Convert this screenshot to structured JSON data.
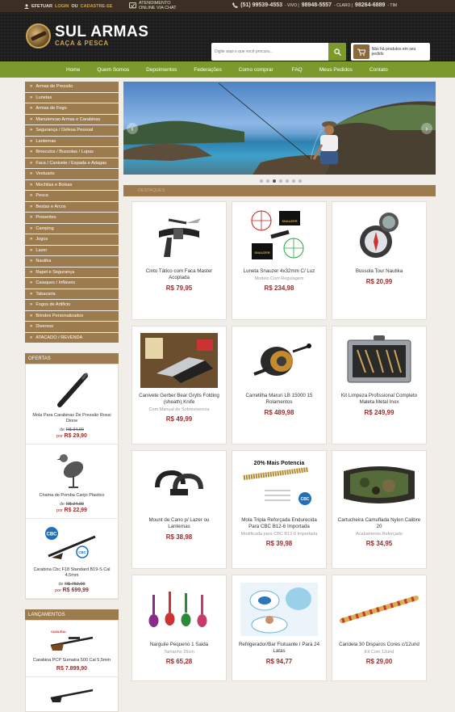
{
  "topbar": {
    "login_pre": "EFETUAR",
    "login_link": "LOGIN",
    "login_or": "OU",
    "register": "CADASTRE-SE",
    "atend_1": "ATENDIMENTO",
    "atend_2": "ONLINE VIA CHAT",
    "phone1": "(51) 99539-4553",
    "phone1_op": "- VIVO |",
    "phone2": "98948-5557",
    "phone2_op": "- CLARO |",
    "phone3": "98264-6889",
    "phone3_op": "- TIM"
  },
  "header": {
    "logo_title": "SUL ARMAS",
    "logo_sub": "CAÇA & PESCA",
    "search_placeholder": "Digite aqui o que você procura...",
    "cart_text": "Não há produtos em seu pedido"
  },
  "nav": [
    "Home",
    "Quem Somos",
    "Depoimentos",
    "Federações",
    "Como comprar",
    "FAQ",
    "Meus Pedidos",
    "Contato"
  ],
  "categories": [
    "Armas de Pressão",
    "Lunetas",
    "Armas de Fogo",
    "Manutencao Armas e Carabinas",
    "Segurança / Defesa Pessoal",
    "Lanternas",
    "Binoculos / Bussolas / Lupas",
    "Faca / Canivete / Espada e Adagas",
    "Vestuario",
    "Mochilas e Bolsas",
    "Pesca",
    "Bestas e Arcos",
    "Presentes",
    "Camping",
    "Jogos",
    "Lazer",
    "Nautika",
    "Rapel e Segurança",
    "Caiaques / Infláveis",
    "Tabacaria",
    "Fogos de Artificio",
    "Brindes Personalizados",
    "Diversos",
    "ATACADO / REVENDA"
  ],
  "offers": {
    "title": "OFERTAS",
    "de_label": "de",
    "por_label": "por",
    "items": [
      {
        "name": "Mola Para Carabinas De Pressão Rossi Dione",
        "old": "R$ 34,90",
        "new": "R$ 29,90"
      },
      {
        "name": "Chama de Pomba Carijo Plastico",
        "old": "R$ 24,90",
        "new": "R$ 22,99"
      },
      {
        "name": "Carabina Cbc F18 Standard B19-S Cal 4,5mm",
        "old": "R$ 759,99",
        "new": "R$ 699,99"
      }
    ]
  },
  "launches": {
    "title": "LANÇAMENTOS",
    "items": [
      {
        "name": "Carabina PCP Sumatra 500 Cal 5,5mm",
        "price": "R$ 7.899,90"
      }
    ]
  },
  "section_title": "DESTAQUES",
  "products": [
    {
      "name": "Cinto Tático com Faca Master Acoplada",
      "sub": "",
      "price": "R$ 79,95",
      "icon": "belt-knife"
    },
    {
      "name": "Luneta Snauzer 4x32mm C/ Luz",
      "sub": "Modelo Com Regulagem",
      "price": "R$ 234,98",
      "icon": "scope"
    },
    {
      "name": "Bussola Tour Nautika",
      "sub": "",
      "price": "R$ 20,99",
      "icon": "compass"
    },
    {
      "name": "Canivete Gerber Bear Grylls Folding (sheath) Knife",
      "sub": "Com Manual de Sobrevivencia",
      "price": "R$ 49,99",
      "icon": "knife"
    },
    {
      "name": "Carretilha Maruri LB 15000 15 Rolamentos",
      "sub": "",
      "price": "R$ 489,98",
      "icon": "reel"
    },
    {
      "name": "Kit Limpeza Profissional Completo Maleta Metal Inox",
      "sub": "",
      "price": "R$ 249,99",
      "icon": "case"
    },
    {
      "name": "Mount de Cano p/ Lazer ou Lanternas",
      "sub": "",
      "price": "R$ 38,98",
      "icon": "mount"
    },
    {
      "name": "Mola Tripla Reforçada Endurecida Para CBC B12-6 Importada",
      "sub": "Modificada para CBC B12-6 Importada",
      "price": "R$ 39,98",
      "icon": "spring",
      "promo": "20% Mais Potencia"
    },
    {
      "name": "Cartucheira Camuflada Nylon Calibre 20",
      "sub": "Acabamento Reforçado",
      "price": "R$ 34,95",
      "icon": "belt"
    },
    {
      "name": "Narguile Pequeno 1 Saida",
      "sub": "Tamanho 25cm",
      "price": "R$ 65,28",
      "icon": "hookah"
    },
    {
      "name": "Refrigerador/Bar Flutuante I Para 24 Latas",
      "sub": "",
      "price": "R$ 94,77",
      "icon": "float"
    },
    {
      "name": "Candela 30 Disparos Cores c/12und",
      "sub": "Kit Com 12und",
      "price": "R$ 29,00",
      "icon": "candle"
    }
  ],
  "colors": {
    "brown": "#9c7b4e",
    "green": "#7b9a2b",
    "price": "#9c2b2b"
  }
}
